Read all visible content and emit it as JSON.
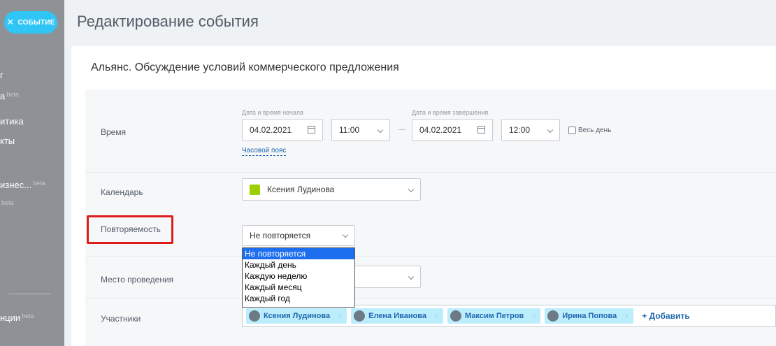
{
  "sidebar": {
    "close_label": "СОБЫТИЕ",
    "items": [
      {
        "label": "г",
        "beta": ""
      },
      {
        "label": "а",
        "beta": "beta"
      },
      {
        "label": "итика",
        "beta": ""
      },
      {
        "label": "кты",
        "beta": ""
      },
      {
        "label": "изнес...",
        "beta": "beta"
      },
      {
        "label": "",
        "beta": "beta"
      },
      {
        "label": "нции",
        "beta": "beta"
      }
    ]
  },
  "header": {
    "title": "Редактирование события"
  },
  "event": {
    "name": "Альянс. Обсуждение условий коммерческого предложения"
  },
  "form": {
    "time": {
      "label": "Время",
      "start_label": "Дата и время начала",
      "end_label": "Дата и время завершения",
      "start_date": "04.02.2021",
      "start_time": "11:00",
      "end_date": "04.02.2021",
      "end_time": "12:00",
      "separator": "—",
      "all_day": "Весь день",
      "timezone_link": "Часовой пояс"
    },
    "calendar": {
      "label": "Календарь",
      "value": "Ксения Лудинова",
      "color": "#9dcf00"
    },
    "repeat": {
      "label": "Повторяемость",
      "value": "Не повторяется",
      "options": [
        "Не повторяется",
        "Каждый день",
        "Каждую неделю",
        "Каждый месяц",
        "Каждый год"
      ],
      "selected_index": 0
    },
    "location": {
      "label": "Место проведения",
      "value": ""
    },
    "participants": {
      "label": "Участники",
      "people": [
        {
          "name": "Ксения Лудинова"
        },
        {
          "name": "Елена Иванова"
        },
        {
          "name": "Максим Петров"
        },
        {
          "name": "Ирина Попова"
        }
      ],
      "remove_glyph": "×",
      "add_label": "+ Добавить"
    }
  },
  "colors": {
    "accent": "#2fc6f6",
    "link": "#2067b0",
    "highlight": "#e01b1b"
  }
}
